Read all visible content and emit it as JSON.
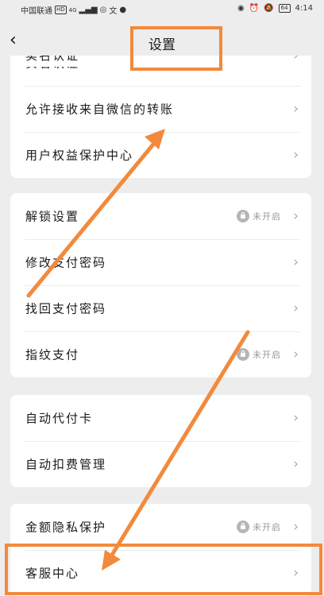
{
  "status_bar": {
    "carrier": "中国联通",
    "hd": "HD",
    "network": "4G",
    "icons_left": [
      "signal-icon",
      "hotspot-icon",
      "wen-icon",
      "wechat-icon"
    ],
    "icons_right": [
      "eye-icon",
      "alarm-icon",
      "mute-icon"
    ],
    "battery": "64",
    "time": "4:14"
  },
  "nav": {
    "back_icon": "‹",
    "title": "设置"
  },
  "groups": [
    {
      "items": [
        {
          "label": "实名认证",
          "status": ""
        },
        {
          "label": "允许接收来自微信的转账",
          "status": ""
        },
        {
          "label": "用户权益保护中心",
          "status": ""
        }
      ]
    },
    {
      "items": [
        {
          "label": "解锁设置",
          "status": "未开启"
        },
        {
          "label": "修改支付密码",
          "status": ""
        },
        {
          "label": "找回支付密码",
          "status": ""
        },
        {
          "label": "指纹支付",
          "status": "未开启"
        }
      ]
    },
    {
      "items": [
        {
          "label": "自动代付卡",
          "status": ""
        },
        {
          "label": "自动扣费管理",
          "status": ""
        }
      ]
    },
    {
      "items": [
        {
          "label": "金额隐私保护",
          "status": "未开启"
        },
        {
          "label": "客服中心",
          "status": ""
        }
      ]
    }
  ],
  "annotation_color": "#f28a3c",
  "chevron_icon": "›"
}
